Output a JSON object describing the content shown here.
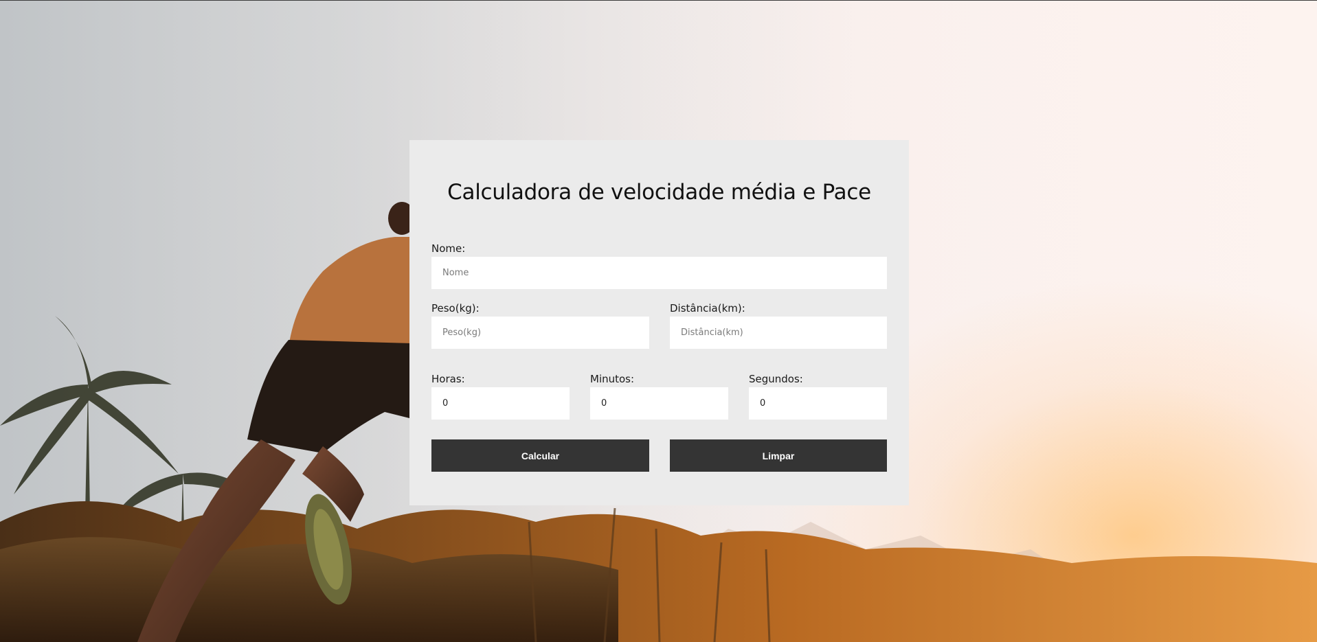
{
  "form": {
    "title": "Calculadora de velocidade média e Pace",
    "nome": {
      "label": "Nome:",
      "placeholder": "Nome",
      "value": ""
    },
    "peso": {
      "label": "Peso(kg):",
      "placeholder": "Peso(kg)",
      "value": ""
    },
    "distancia": {
      "label": "Distância(km):",
      "placeholder": "Distância(km)",
      "value": ""
    },
    "horas": {
      "label": "Horas:",
      "value": "0"
    },
    "minutos": {
      "label": "Minutos:",
      "value": "0"
    },
    "segundos": {
      "label": "Segundos:",
      "value": "0"
    },
    "calcular_label": "Calcular",
    "limpar_label": "Limpar"
  },
  "colors": {
    "card_bg": "#ebebeb",
    "button_bg": "#343434",
    "button_text": "#ffffff",
    "input_bg": "#ffffff"
  }
}
